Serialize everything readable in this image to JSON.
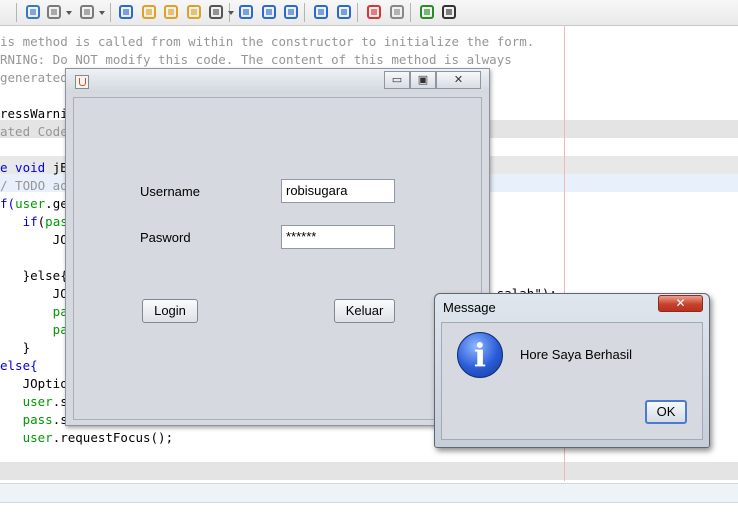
{
  "toolbar": {
    "buttons": [
      {
        "name": "toggle-bookmark-icon",
        "color": "#3a78c8"
      },
      {
        "name": "shift-left-icon",
        "color": "#7a7a7a"
      },
      {
        "name": "shift-right-icon",
        "color": "#7a7a7a"
      },
      {
        "name": "find-icon",
        "color": "#2a6ad0"
      },
      {
        "name": "find-previous-icon",
        "color": "#e0a020"
      },
      {
        "name": "find-next-icon",
        "color": "#e0a020"
      },
      {
        "name": "toggle-highlight-icon",
        "color": "#e0a020"
      },
      {
        "name": "find-selection-icon",
        "color": "#555555"
      },
      {
        "name": "previous-bookmark-icon",
        "color": "#2a6ad0"
      },
      {
        "name": "next-bookmark-icon",
        "color": "#2a6ad0"
      },
      {
        "name": "toggle-bookmarks-icon",
        "color": "#2a6ad0"
      },
      {
        "name": "shift-line-left-icon",
        "color": "#2a6ad0"
      },
      {
        "name": "shift-line-right-icon",
        "color": "#2a6ad0"
      },
      {
        "name": "start-macro-icon",
        "color": "#e03030"
      },
      {
        "name": "stop-macro-icon",
        "color": "#888888"
      },
      {
        "name": "comment-icon",
        "color": "#2a8a2a"
      },
      {
        "name": "uncomment-icon",
        "color": "#333333"
      }
    ]
  },
  "editor": {
    "lines": [
      [
        {
          "t": "is method is called from within the constructor to initialize the form.",
          "c": "c-com"
        }
      ],
      [
        {
          "t": "RNING: Do NOT modify this code. The content of this method is always",
          "c": "c-com"
        }
      ],
      [
        {
          "t": "generated by the Form Editor.",
          "c": "c-com"
        }
      ],
      [],
      [
        {
          "t": "ressWarnings(\"unchecked\")",
          "c": "c-plain"
        }
      ],
      [
        {
          "t": "ated Code",
          "c": "c-com"
        }
      ],
      [],
      [
        {
          "t": "e void ",
          "c": "c-kw"
        },
        {
          "t": "jButton1ActionPerformed(java.awt.event.ActionEvent evt) {",
          "c": "c-plain"
        }
      ],
      [
        {
          "t": "/ TODO add your handling code here:",
          "c": "c-com"
        }
      ],
      [
        {
          "t": "f(",
          "c": "c-kw"
        },
        {
          "t": "user",
          "c": "c-fld"
        },
        {
          "t": ".getText().equals(\"robisugara\")){",
          "c": "c-plain"
        }
      ],
      [
        {
          "t": "   if",
          "c": "c-kw"
        },
        {
          "t": "(",
          "c": "c-plain"
        },
        {
          "t": "pass",
          "c": "c-fld"
        },
        {
          "t": ".getText().equals(\"123456\")){",
          "c": "c-plain"
        }
      ],
      [
        {
          "t": "       JOptionPane.showMessageDialog(null, \"Hore Saya Berhasil\");",
          "c": "c-plain"
        }
      ],
      [],
      [
        {
          "t": "   }else{",
          "c": "c-plain"
        }
      ],
      [
        {
          "t": "       JOptionPane.showMessageDialog(null, \"Password anda masukan salah\");",
          "c": "c-plain"
        }
      ],
      [
        {
          "t": "       pass",
          "c": "c-fld"
        },
        {
          "t": ".setText(\"\");",
          "c": "c-plain"
        }
      ],
      [
        {
          "t": "       pass",
          "c": "c-fld"
        },
        {
          "t": ".requestFocus();",
          "c": "c-plain"
        }
      ],
      [
        {
          "t": "   }",
          "c": "c-plain"
        }
      ],
      [
        {
          "t": "else{",
          "c": "c-kw"
        }
      ],
      [
        {
          "t": "   JOptionPane.showMessageDialog(null, \"Username anda salah\");",
          "c": "c-plain"
        }
      ],
      [
        {
          "t": "   user",
          "c": "c-fld"
        },
        {
          "t": ".setText(\"\");",
          "c": "c-plain"
        }
      ],
      [
        {
          "t": "   pass",
          "c": "c-fld"
        },
        {
          "t": ".setText(\"\");",
          "c": "c-plain"
        }
      ],
      [
        {
          "t": "   user",
          "c": "c-fld"
        },
        {
          "t": ".requestFocus();",
          "c": "c-plain"
        }
      ]
    ]
  },
  "login_frame": {
    "minimize": "▭",
    "maximize": "▣",
    "close": "✕",
    "username_label": "Username",
    "username_value": "robisugara",
    "password_label": "Pasword",
    "password_value": "******",
    "login_button": "Login",
    "exit_button": "Keluar"
  },
  "message_dialog": {
    "title": "Message",
    "close": "✕",
    "icon": "i",
    "message": "Hore Saya Berhasil",
    "ok_button": "OK"
  }
}
